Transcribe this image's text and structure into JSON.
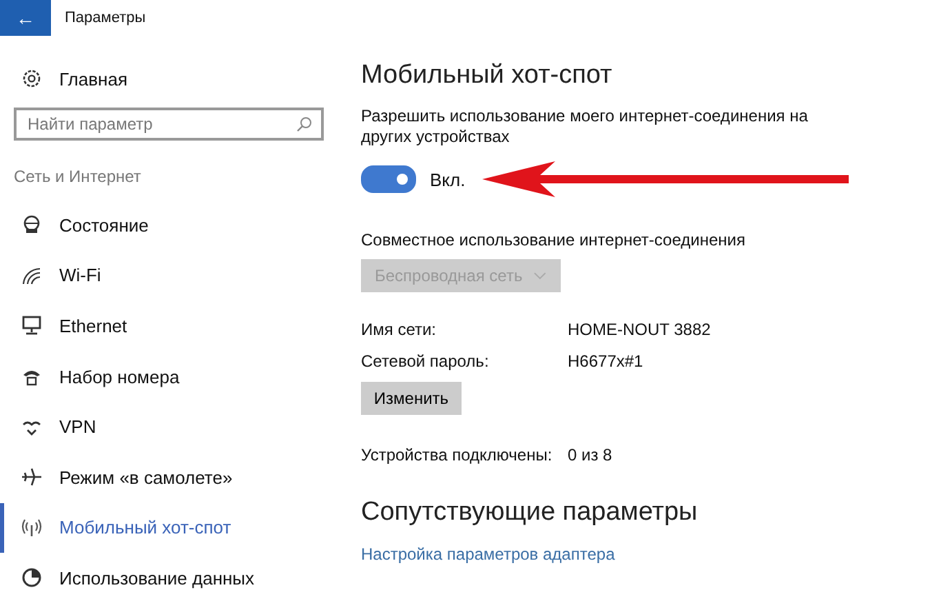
{
  "window": {
    "title": "Параметры",
    "back": "←"
  },
  "sidebar": {
    "home": "Главная",
    "search": {
      "placeholder": "Найти параметр"
    },
    "section": "Сеть и Интернет",
    "items": [
      {
        "label": "Состояние",
        "kind": "status",
        "selected": false
      },
      {
        "label": "Wi-Fi",
        "kind": "wifi",
        "selected": false
      },
      {
        "label": "Ethernet",
        "kind": "ethernet",
        "selected": false
      },
      {
        "label": "Набор номера",
        "kind": "dialup",
        "selected": false
      },
      {
        "label": "VPN",
        "kind": "vpn",
        "selected": false
      },
      {
        "label": "Режим «в самолете»",
        "kind": "airplane",
        "selected": false
      },
      {
        "label": "Мобильный хот-спот",
        "kind": "hotspot",
        "selected": true
      },
      {
        "label": "Использование данных",
        "kind": "data",
        "selected": false
      }
    ]
  },
  "main": {
    "title": "Мобильный хот-спот",
    "share_label": "Разрешить использование моего интернет-соединения на других устройствах",
    "toggle": {
      "on": true,
      "label": "Вкл."
    },
    "source_label": "Совместное использование интернет-соединения",
    "source": {
      "value": "Беспроводная сеть",
      "disabled": true
    },
    "fields": [
      {
        "label": "Имя сети:",
        "value": "HOME-NOUT 3882"
      },
      {
        "label": "Сетевой пароль:",
        "value": "H6677x#1"
      }
    ],
    "edit_button": "Изменить",
    "devices": {
      "label": "Устройства подключены:",
      "value": "0 из 8"
    },
    "related_title": "Сопутствующие параметры",
    "related_link": "Настройка параметров адаптера"
  }
}
